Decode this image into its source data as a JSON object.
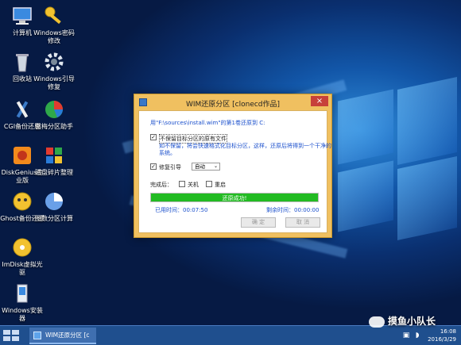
{
  "desktop": {
    "icons": [
      {
        "label": "计算机",
        "icon": "computer-icon"
      },
      {
        "label": "Windows密码修改",
        "icon": "key-icon"
      },
      {
        "label": "回收站",
        "icon": "recycle-bin-icon"
      },
      {
        "label": "Windows引导修复",
        "icon": "gear-icon"
      },
      {
        "label": "CGI备份还原",
        "icon": "tools-icon"
      },
      {
        "label": "傲梅分区助手",
        "icon": "partition-pie-icon"
      },
      {
        "label": "DiskGenius专业版",
        "icon": "diskgenius-icon"
      },
      {
        "label": "磁盘碎片整理",
        "icon": "defrag-blocks-icon"
      },
      {
        "label": "Ghost备份还原",
        "icon": "ghost-icon"
      },
      {
        "label": "图数分区计算",
        "icon": "pie-chart-icon"
      },
      {
        "label": "ImDisk虚拟光驱",
        "icon": "disc-icon"
      },
      {
        "label": "Windows安装器",
        "icon": "installer-icon"
      }
    ]
  },
  "dialog": {
    "title": "WIM还原分区 [clonecd作品]",
    "close_label": "×",
    "source_line": "用\"F:\\sources\\install.wim\"的第1卷还原到 C:",
    "keep_files_checked": true,
    "keep_files_label": "不保留目标分区的原有文件",
    "keep_files_note_1": "如不保留，将会快速格式化目标分区，这样，还原后将得到一个干净的",
    "keep_files_note_2": "系统。",
    "repair_boot_checked": true,
    "repair_boot_label": "修复引导",
    "repair_boot_option": "自动",
    "after_label": "完成后：",
    "shutdown_label": "关机",
    "restart_label": "重启",
    "progress_text": "还原成功!",
    "progress_percent": 100,
    "progress_color": "#22bb22",
    "elapsed": "已用时间：00:07:50",
    "remaining": "剩余时间：00:00:00",
    "ok_label": "确 定",
    "cancel_label": "取 消"
  },
  "taskbar": {
    "task_label": "WIM还原分区 [c",
    "time": "16:08",
    "date": "2016/3/29"
  },
  "watermark": "摸鱼小队长"
}
